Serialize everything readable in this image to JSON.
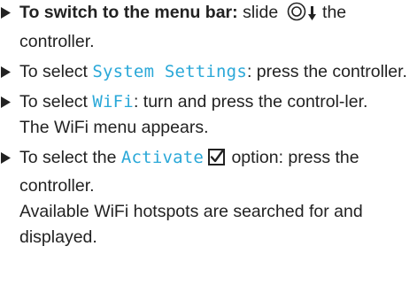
{
  "steps": [
    {
      "lead": "To switch to the menu bar:",
      "pre": " slide ",
      "post": " the controller.",
      "icons": [
        "controller-icon",
        "slide-down-arrow-icon"
      ]
    },
    {
      "pre": "To select ",
      "menu": "System Settings",
      "post": ": press the controller."
    },
    {
      "pre": "To select ",
      "menu": "WiFi",
      "post": ": turn and press the control-ler.",
      "result": "The WiFi menu appears."
    },
    {
      "pre": "To select the ",
      "menu": "Activate",
      "post": " option: press the controller.",
      "icons": [
        "checkbox-checked-icon"
      ],
      "result": "Available WiFi hotspots are searched for and displayed."
    }
  ],
  "icons": {
    "bullet": "right-triangle-bullet-icon"
  },
  "colors": {
    "menu_text": "#2aa8d8",
    "body_text": "#222222"
  }
}
